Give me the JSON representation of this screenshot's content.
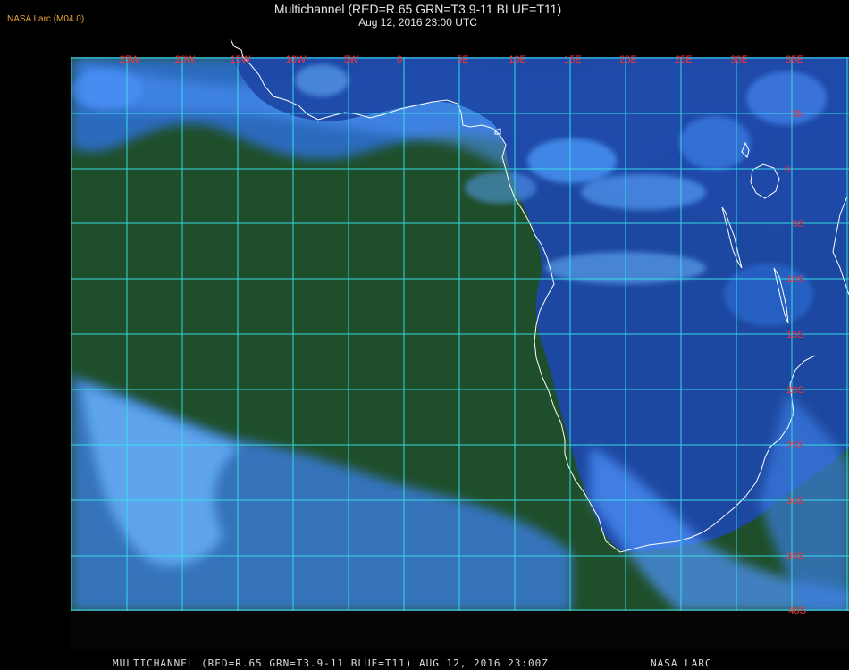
{
  "header": {
    "badge": "NASA Larc (M04.0)",
    "title": "Multichannel (RED=R.65 GRN=T3.9-11 BLUE=T11)",
    "subtitle": "Aug 12, 2016 23:00 UTC"
  },
  "map": {
    "longitude_labels": [
      "25W",
      "20W",
      "15W",
      "10W",
      "5W",
      "0",
      "5E",
      "10E",
      "15E",
      "20E",
      "25E",
      "30E",
      "35E"
    ],
    "latitude_labels": [
      "5N",
      "0",
      "5S",
      "10S",
      "15S",
      "20S",
      "25S",
      "30S",
      "35S",
      "40S"
    ],
    "colors": {
      "ocean": "#1f4f2a",
      "land": "#1a3f8a",
      "cloud": "#5aa6ff",
      "grid": "#38e0e8",
      "label": "#ff3030",
      "coast": "#ffffff"
    }
  },
  "footer": {
    "caption": "MULTICHANNEL (RED=R.65 GRN=T3.9-11 BLUE=T11) AUG 12, 2016 23:00Z",
    "credit": "NASA LARC"
  }
}
